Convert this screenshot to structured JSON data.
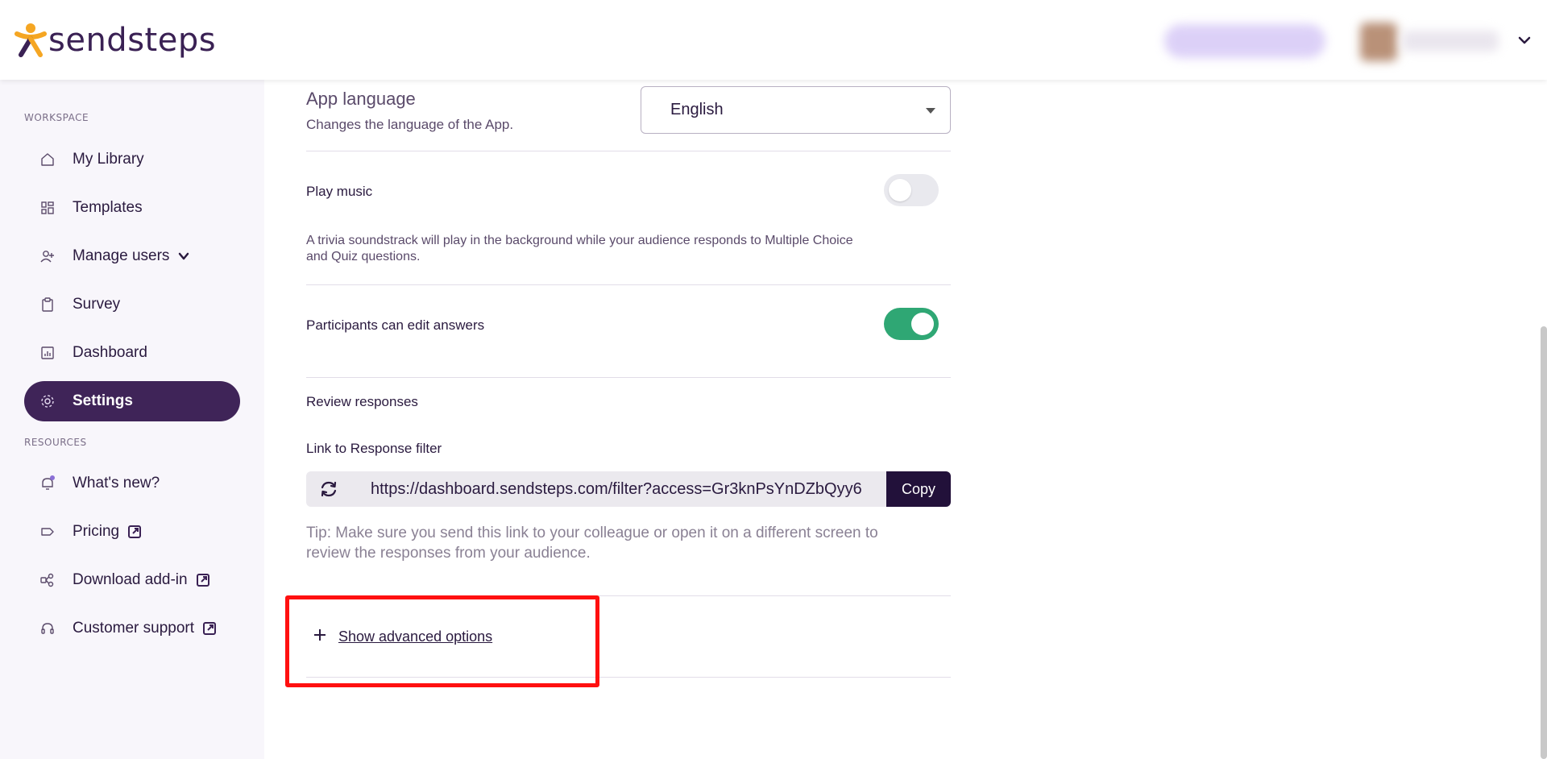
{
  "header": {
    "brand": "sendsteps",
    "brand_colors": {
      "primary": "#3a2154",
      "accent": "#f5a623"
    }
  },
  "sidebar": {
    "workspace_label": "WORKSPACE",
    "resources_label": "RESOURCES",
    "workspace_items": [
      {
        "label": "My Library",
        "icon": "home-icon"
      },
      {
        "label": "Templates",
        "icon": "grid-icon"
      },
      {
        "label": "Manage users",
        "icon": "add-user-icon"
      },
      {
        "label": "Survey",
        "icon": "clipboard-icon"
      },
      {
        "label": "Dashboard",
        "icon": "chart-icon"
      },
      {
        "label": "Settings",
        "icon": "gear-icon",
        "active": true
      }
    ],
    "resource_items": [
      {
        "label": "What's new?",
        "icon": "bell-icon"
      },
      {
        "label": "Pricing",
        "icon": "tag-icon"
      },
      {
        "label": "Download add-in",
        "icon": "puzzle-icon"
      },
      {
        "label": "Customer support",
        "icon": "headset-icon"
      }
    ]
  },
  "settings": {
    "app_language": {
      "title": "App language",
      "description": "Changes the language of the App.",
      "selected": "English"
    },
    "play_music": {
      "title": "Play music",
      "description_line1": "A trivia soundstrack will play in the background while your audience responds to Multiple Choice",
      "description_line2": "and Quiz questions.",
      "enabled": false
    },
    "edit_answers": {
      "title": "Participants can edit answers",
      "enabled": true
    },
    "review": {
      "title": "Review responses",
      "link_label": "Link to Response filter",
      "link_url": "https://dashboard.sendsteps.com/filter?access=Gr3knPsYnDZbQyy6",
      "copy_label": "Copy",
      "tip_line1": "Tip: Make sure you send this link to your colleague or open it on a different screen to",
      "tip_line2": "review the responses from your audience."
    },
    "advanced": {
      "label": "Show advanced options"
    }
  },
  "colors": {
    "active_nav": "#3f2458",
    "toggle_on": "#2fa774",
    "copy_button": "#22113a",
    "highlight": "#ff1010"
  }
}
